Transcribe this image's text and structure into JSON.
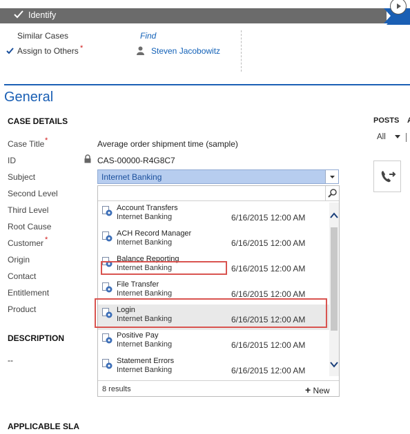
{
  "process": {
    "stage_label": "Identify",
    "steps": [
      {
        "label": "Similar Cases",
        "value": "Find",
        "checked": false
      },
      {
        "label": "Assign to Others",
        "value": "Steven Jacobowitz",
        "checked": true,
        "required": true
      }
    ]
  },
  "section": {
    "title": "General",
    "case_details_heading": "CASE DETAILS"
  },
  "fields": [
    {
      "label": "Case Title",
      "required": true,
      "value": "Average order shipment time (sample)"
    },
    {
      "label": "ID",
      "required": false,
      "value": "CAS-00000-R4G8C7",
      "locked": true
    },
    {
      "label": "Subject",
      "required": false,
      "value": "Internet Banking"
    },
    {
      "label": "Second Level",
      "required": false
    },
    {
      "label": "Third Level",
      "required": false
    },
    {
      "label": "Root Cause",
      "required": false
    },
    {
      "label": "Customer",
      "required": true
    },
    {
      "label": "Origin",
      "required": false
    },
    {
      "label": "Contact",
      "required": false
    },
    {
      "label": "Entitlement",
      "required": false
    },
    {
      "label": "Product",
      "required": false
    }
  ],
  "required_marker": "*",
  "description": {
    "heading": "DESCRIPTION",
    "value": "--"
  },
  "sla_heading": "APPLICABLE SLA",
  "lookup": {
    "search_value": "",
    "results": [
      {
        "name": "Account Transfers",
        "subject": "Internet Banking",
        "date": "6/16/2015 12:00 AM"
      },
      {
        "name": "ACH Record Manager",
        "subject": "Internet Banking",
        "date": "6/16/2015 12:00 AM"
      },
      {
        "name": "Balance Reporting",
        "subject": "Internet Banking",
        "date": "6/16/2015 12:00 AM"
      },
      {
        "name": "File Transfer",
        "subject": "Internet Banking",
        "date": "6/16/2015 12:00 AM"
      },
      {
        "name": "Login",
        "subject": "Internet Banking",
        "date": "6/16/2015 12:00 AM"
      },
      {
        "name": "Positive Pay",
        "subject": "Internet Banking",
        "date": "6/16/2015 12:00 AM"
      },
      {
        "name": "Statement Errors",
        "subject": "Internet Banking",
        "date": "6/16/2015 12:00 AM"
      }
    ],
    "count_label": "8 results",
    "new_label": "New"
  },
  "posts": {
    "heading": "POSTS",
    "filter": "All"
  },
  "colors": {
    "accent": "#1a5fb4",
    "highlight": "#d9534f",
    "stage": "#6b6b6b"
  }
}
